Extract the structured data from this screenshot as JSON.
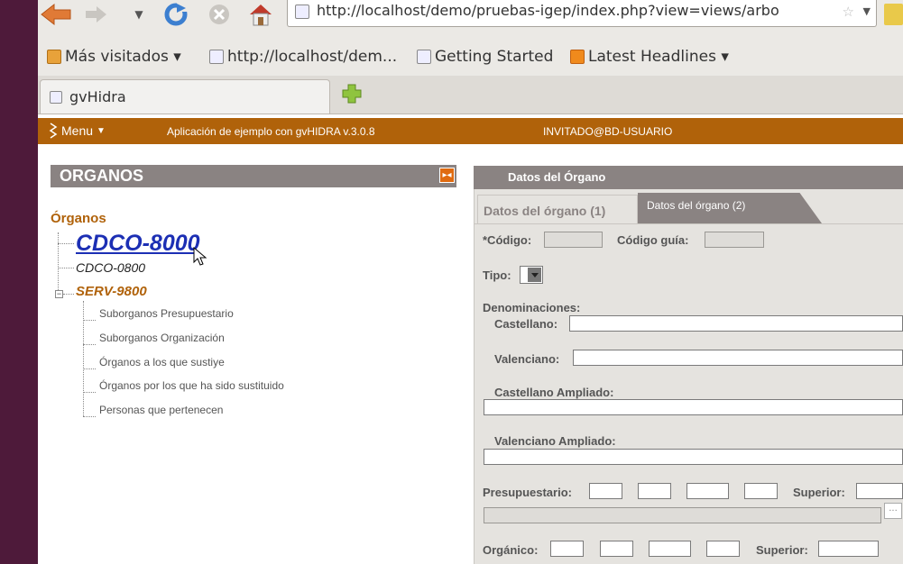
{
  "browser": {
    "url": "http://localhost/demo/pruebas-igep/index.php?view=views/arbo",
    "bookmarks": [
      {
        "label": "Más visitados ▾",
        "icon": "folder-icon"
      },
      {
        "label": "http://localhost/dem...",
        "icon": "page-icon"
      },
      {
        "label": "Getting Started",
        "icon": "page-icon"
      },
      {
        "label": "Latest Headlines ▾",
        "icon": "rss-icon"
      }
    ],
    "tab_title": "gvHidra"
  },
  "app": {
    "menu_label": "Menu",
    "title": "Aplicación de ejemplo con gvHIDRA  v.3.0.8",
    "user": "INVITADO@BD-USUARIO"
  },
  "left_panel": {
    "title": "ORGANOS",
    "tree_root": "Órganos",
    "nodes": [
      "CDCO-8000",
      "CDCO-0800",
      "SERV-9800"
    ],
    "children": [
      "Suborganos Presupuestario",
      "Suborganos Organización",
      "Órganos a los que sustiye",
      "Órganos por los que ha sido sustituido",
      "Personas que pertenecen"
    ]
  },
  "right_panel": {
    "title": "Datos del Órgano",
    "tabs": [
      "Datos del órgano (1)",
      "Datos del órgano (2)"
    ],
    "fields": {
      "codigo": "*Código:",
      "codigo_guia": "Código guía:",
      "tipo": "Tipo:",
      "denominaciones": "Denominaciones:",
      "castellano": "Castellano:",
      "valenciano": "Valenciano:",
      "castellano_ampliado": "Castellano Ampliado:",
      "valenciano_ampliado": "Valenciano Ampliado:",
      "presupuestario": "Presupuestario:",
      "superior_1": "Superior:",
      "organico": "Orgánico:",
      "superior_2": "Superior:",
      "dots": "..."
    }
  },
  "colors": {
    "app_bar": "#b0620a",
    "panel_header": "#8a8382",
    "link": "#1c2fb4",
    "accent": "#b0620a"
  }
}
